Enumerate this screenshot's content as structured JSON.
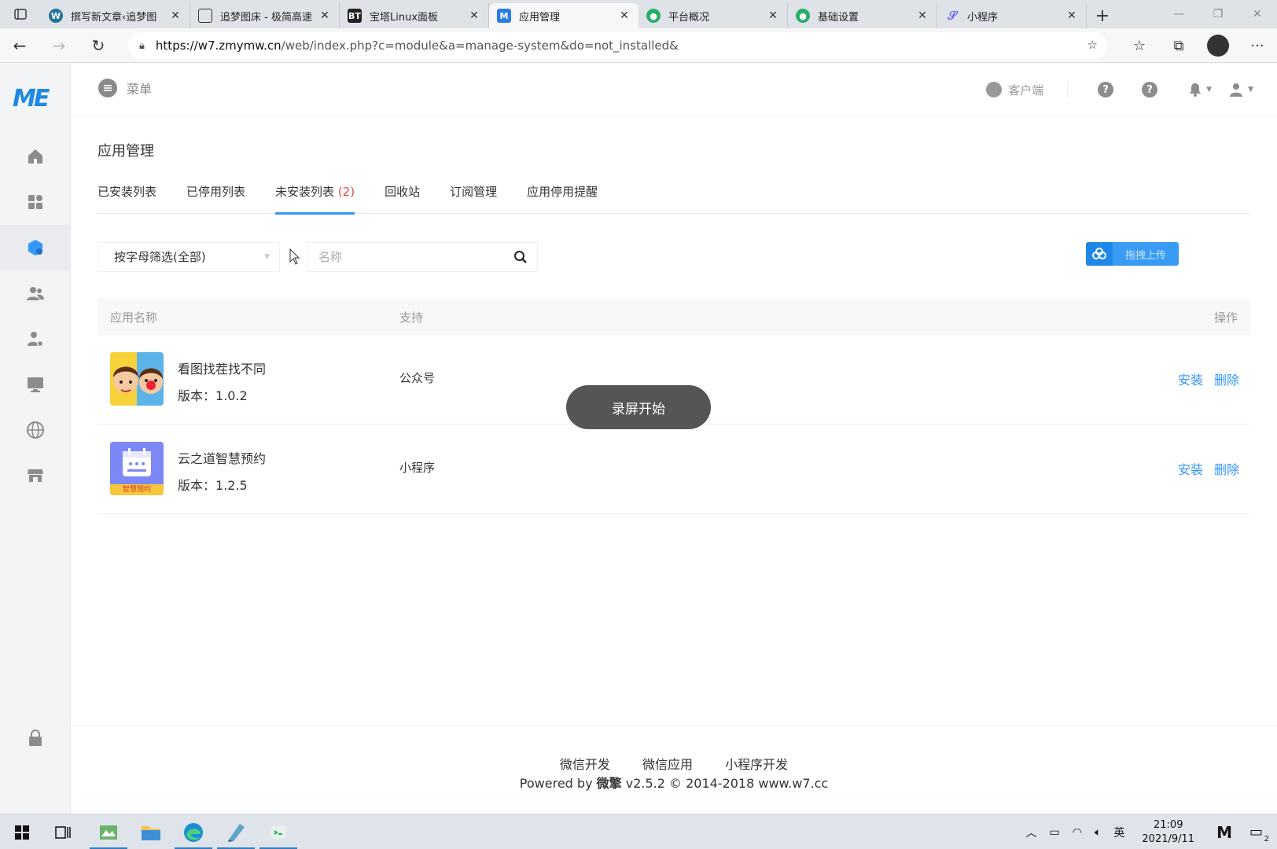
{
  "browser": {
    "tabs": [
      {
        "title": "撰写新文章‹追梦图",
        "favicon": "wordpress-icon"
      },
      {
        "title": "追梦图床 - 极简高速",
        "favicon": "image-icon"
      },
      {
        "title": "宝塔Linux面板",
        "favicon": "bt-icon"
      },
      {
        "title": "应用管理",
        "favicon": "w7-icon",
        "active": true
      },
      {
        "title": "平台概况",
        "favicon": "wechat-icon"
      },
      {
        "title": "基础设置",
        "favicon": "wechat-icon"
      },
      {
        "title": "小程序",
        "favicon": "miniprogram-icon"
      }
    ],
    "url_host": "https://w7.zmymw.cn",
    "url_path": "/web/index.php?c=module&a=manage-system&do=not_installed&"
  },
  "app": {
    "logo": "ME",
    "menu_label": "菜单",
    "client_label": "客户端",
    "page_title": "应用管理",
    "tabs": [
      {
        "label": "已安装列表",
        "count": ""
      },
      {
        "label": "已停用列表",
        "count": ""
      },
      {
        "label": "未安装列表",
        "count": "(2)",
        "active": true
      },
      {
        "label": "回收站",
        "count": ""
      },
      {
        "label": "订阅管理",
        "count": ""
      },
      {
        "label": "应用停用提醒",
        "count": ""
      }
    ],
    "filter_value": "按字母筛选(全部)",
    "search_placeholder": "名称",
    "upload_label": "拖拽上传",
    "table": {
      "headers": [
        "应用名称",
        "支持",
        "操作"
      ],
      "rows": [
        {
          "name": "看图找茬找不同",
          "version_label": "版本：",
          "version": "1.0.2",
          "support": "公众号",
          "install": "安装",
          "delete": "删除"
        },
        {
          "name": "云之道智慧预约",
          "version_label": "版本：",
          "version": "1.2.5",
          "support": "小程序",
          "install": "安装",
          "delete": "删除"
        }
      ]
    },
    "toast": "录屏开始",
    "footer": {
      "links": [
        "微信开发",
        "微信应用",
        "小程序开发"
      ],
      "powered_pre": "Powered by ",
      "powered_brand": "微擎",
      "powered_post": " v2.5.2 © 2014-2018 www.w7.cc"
    },
    "row2_thumb_text": "智慧预约"
  },
  "taskbar": {
    "ime": "英",
    "time": "21:09",
    "date": "2021/9/11",
    "notifications": "2"
  },
  "colors": {
    "accent": "#3296fa",
    "count_red": "#e24b4b",
    "toast_bg": "#555555"
  }
}
